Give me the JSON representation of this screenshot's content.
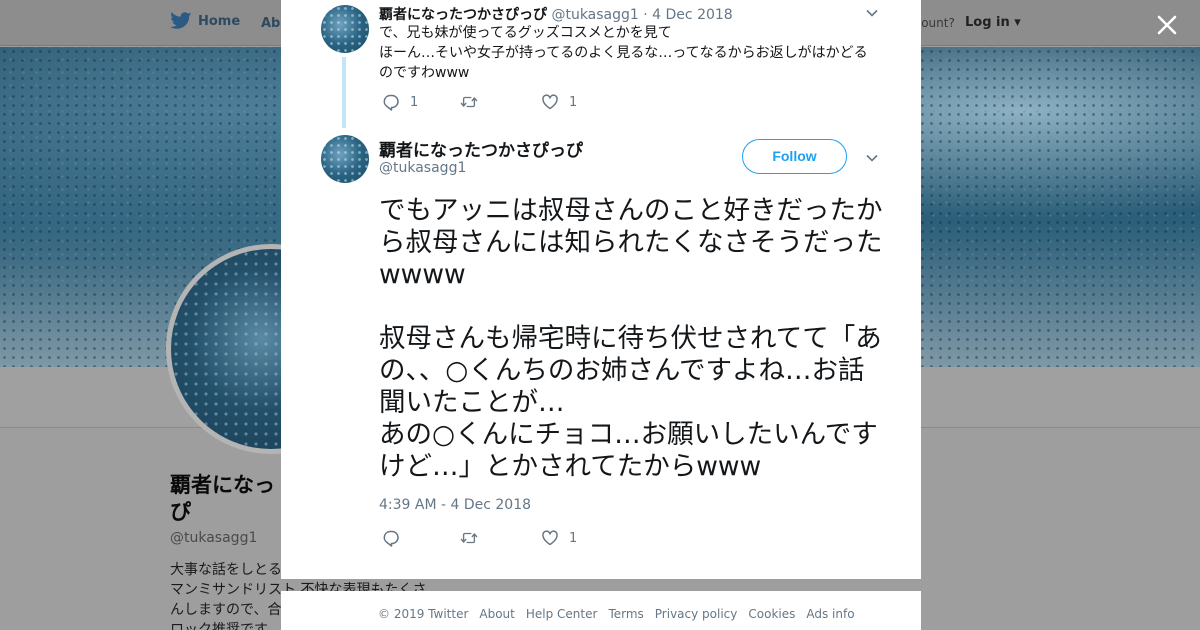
{
  "background": {
    "nav_home": "Home",
    "nav_about": "Abo",
    "nav_account": "ccount?",
    "nav_login": "Log in",
    "profile_name": "覇者になっ\nぴ",
    "profile_handle": "@tukasagg1",
    "profile_bio": "大事な話をしとる\nマンミサンドリスト 不快な表現もたくさ\nんしますので、合\nロック推奨です"
  },
  "modal": {
    "previous_tweet": {
      "display_name": "覇者になったつかさぴっぴ",
      "handle": "@tukasagg1",
      "date": "· 4 Dec 2018",
      "text": "で、兄も妹が使ってるグッズコスメとかを見て\nほーん…そいや女子が持ってるのよく見るな…ってなるからお返しがはかどるのですわwww",
      "reply_count": "1",
      "like_count": "1"
    },
    "main_tweet": {
      "display_name": "覇者になったつかさぴっぴ",
      "handle": "@tukasagg1",
      "follow_label": "Follow",
      "text": "でもアッニは叔母さんのこと好きだったから叔母さんには知られたくなさそうだったwwww\n\n叔母さんも帰宅時に待ち伏せされてて「あの、、○くんちのお姉さんですよね…お話聞いたことが…\nあの○くんにチョコ…お願いしたいんですけど…」とかされてたからwww",
      "timestamp": "4:39 AM - 4 Dec 2018",
      "like_count": "1"
    }
  },
  "footer": {
    "copyright": "© 2019 Twitter",
    "about": "About",
    "help_center": "Help Center",
    "terms": "Terms",
    "privacy": "Privacy policy",
    "cookies": "Cookies",
    "ads_info": "Ads info"
  },
  "icons": {
    "close": "close-icon",
    "reply": "reply-icon",
    "retweet": "retweet-icon",
    "like": "heart-icon",
    "more": "chevron-down-icon",
    "logo": "twitter-bird-icon"
  },
  "colors": {
    "accent": "#1da1f2",
    "secondary_text": "#657786",
    "primary_text": "#14171a"
  }
}
